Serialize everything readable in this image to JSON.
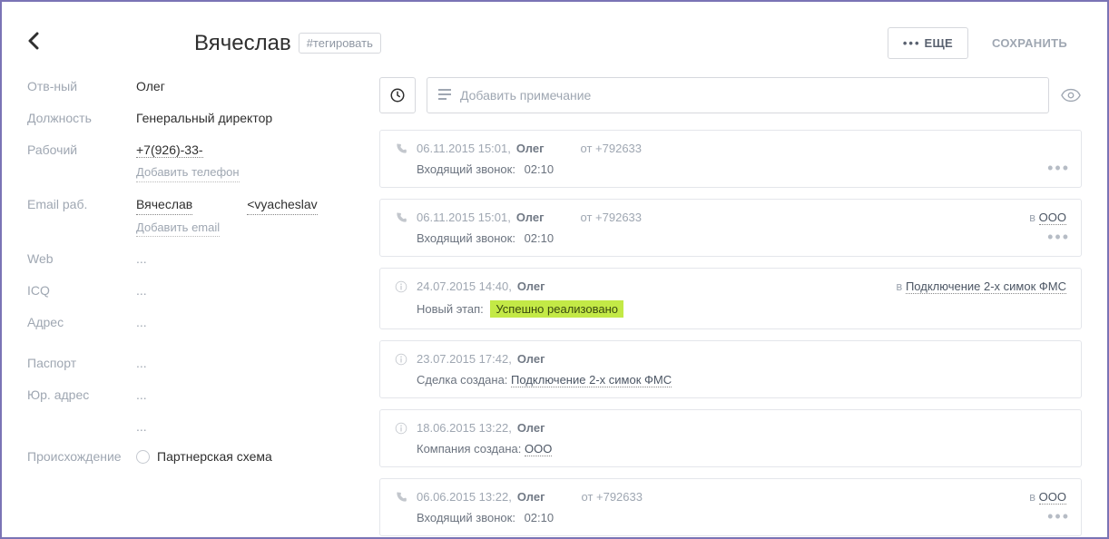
{
  "header": {
    "title": "Вячеслав",
    "tag_label": "#тегировать",
    "more_label": "ЕЩЕ",
    "save_label": "СОХРАНИТЬ"
  },
  "fields": {
    "responsible_label": "Отв-ный",
    "responsible_value": "Олег",
    "position_label": "Должность",
    "position_value": "Генеральный директор",
    "work_phone_label": "Рабочий",
    "work_phone_value": "+7(926)-33-",
    "add_phone": "Добавить телефон",
    "email_label": "Email раб.",
    "email_name": "Вячеслав ",
    "email_addr": "<vyacheslav",
    "add_email": "Добавить email",
    "web_label": "Web",
    "web_value": "...",
    "icq_label": "ICQ",
    "icq_value": "...",
    "address_label": "Адрес",
    "address_value": "...",
    "passport_label": "Паспорт",
    "passport_value": "...",
    "legal_addr_label": "Юр. адрес",
    "legal_addr_value": "...",
    "extra_value": "...",
    "origin_label": "Происхождение",
    "origin_value": "Партнерская схема"
  },
  "note": {
    "placeholder": "Добавить примечание"
  },
  "feed": [
    {
      "type": "call",
      "timestamp": "06.11.2015 15:01,",
      "owner": "Олег",
      "from": "от +792633",
      "body_label": "Входящий звонок:",
      "duration": "02:10",
      "link_prefix": "",
      "link_text": ""
    },
    {
      "type": "call",
      "timestamp": "06.11.2015 15:01,",
      "owner": "Олег",
      "from": "от +792633",
      "body_label": "Входящий звонок:",
      "duration": "02:10",
      "link_prefix": "в ",
      "link_text": "ООО "
    },
    {
      "type": "info",
      "timestamp": "24.07.2015 14:40,",
      "owner": "Олег",
      "from": "",
      "body_label": "Новый этап:",
      "stage": "Успешно реализовано",
      "link_prefix": "в ",
      "link_text": "Подключение 2-х симок ФМС"
    },
    {
      "type": "info",
      "timestamp": "23.07.2015 17:42,",
      "owner": "Олег",
      "from": "",
      "body_label": "Сделка создана:",
      "body_link": "Подключение 2-х симок ФМС",
      "link_prefix": "",
      "link_text": ""
    },
    {
      "type": "info",
      "timestamp": "18.06.2015 13:22,",
      "owner": "Олег",
      "from": "",
      "body_label": "Компания создана:",
      "body_link": "ООО ",
      "link_prefix": "",
      "link_text": ""
    },
    {
      "type": "call",
      "timestamp": "06.06.2015 13:22,",
      "owner": "Олег",
      "from": "от +792633",
      "body_label": "Входящий звонок:",
      "duration": "02:10",
      "link_prefix": "в ",
      "link_text": "ООО "
    }
  ]
}
